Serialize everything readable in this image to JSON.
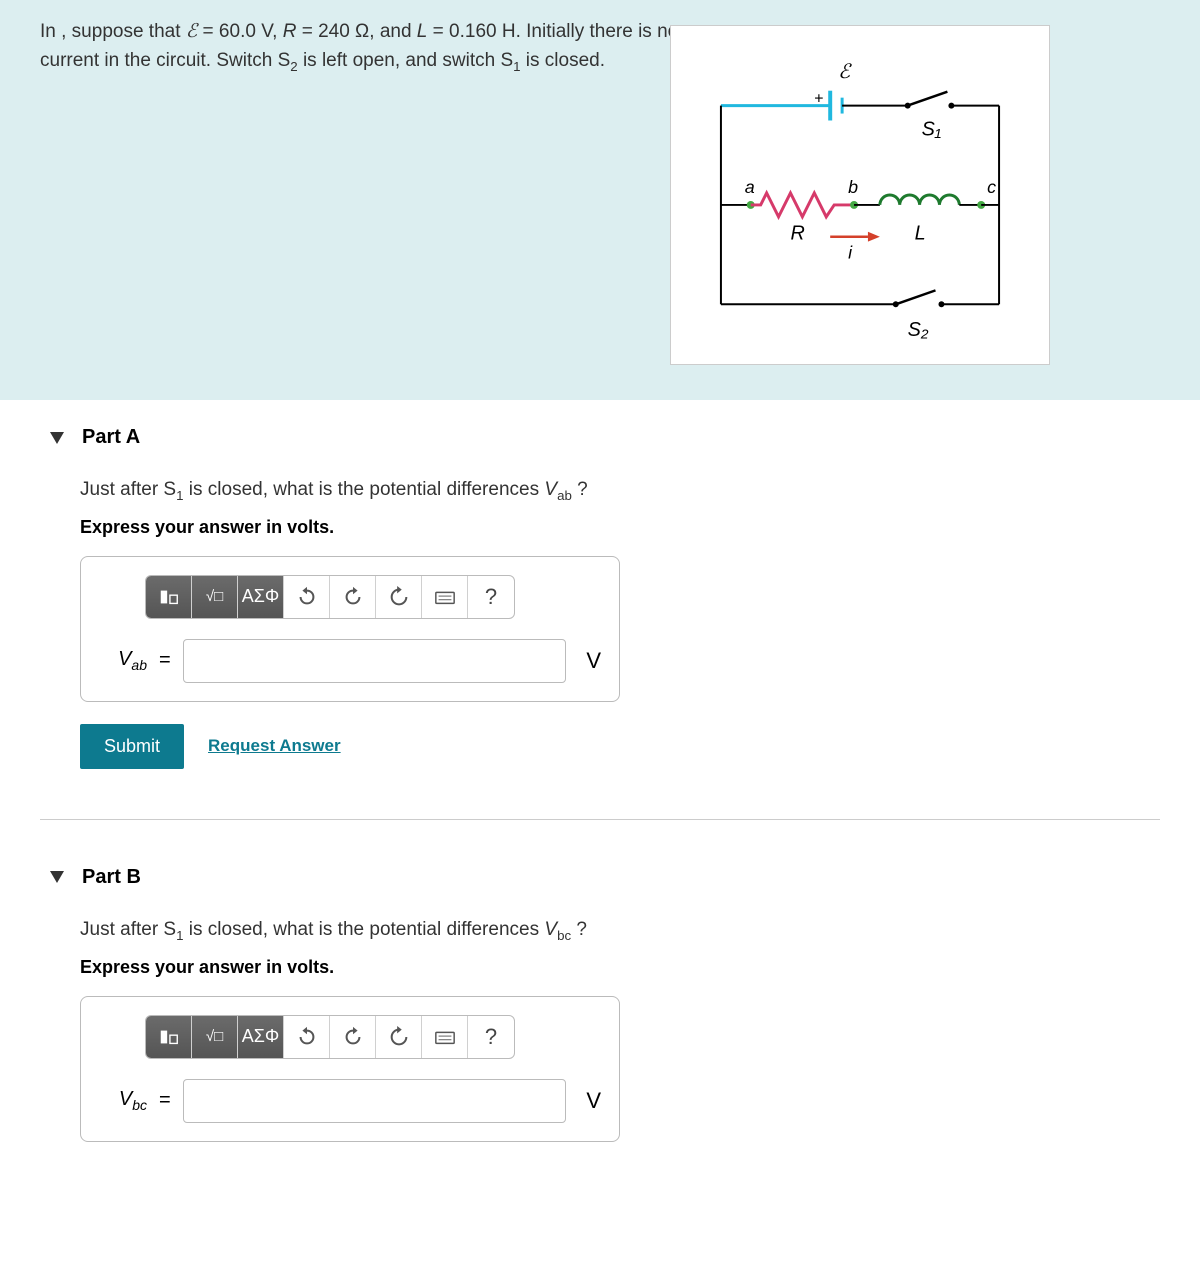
{
  "problem": {
    "text_html": "In , suppose that <i>ℰ</i> = 60.0 V, <i>R</i> = 240 Ω, and <i>L</i> = 0.160 H. Initially there is no current in the circuit. Switch S<sub>2</sub> is left open, and switch S<sub>1</sub> is closed."
  },
  "figure_labels": {
    "emf": "ℰ",
    "plus": "+",
    "s1": "S₁",
    "s2": "S₂",
    "a": "a",
    "b": "b",
    "c": "c",
    "r": "R",
    "l": "L",
    "i": "i"
  },
  "parts": [
    {
      "id": "A",
      "title": "Part A",
      "question_html": "Just after S<sub>1</sub> is closed, what is the potential differences <i>V</i><sub>ab</sub> ?",
      "hint": "Express your answer in volts.",
      "var_label_html": "<i>V</i><sub>ab</sub>",
      "unit": "V",
      "toolbar": {
        "greek": "ΑΣΦ",
        "help": "?"
      },
      "submit": "Submit",
      "request": "Request Answer"
    },
    {
      "id": "B",
      "title": "Part B",
      "question_html": "Just after S<sub>1</sub> is closed, what is the potential differences <i>V</i><sub>bc</sub> ?",
      "hint": "Express your answer in volts.",
      "var_label_html": "<i>V</i><sub>bc</sub>",
      "unit": "V",
      "toolbar": {
        "greek": "ΑΣΦ",
        "help": "?"
      },
      "submit": "Submit",
      "request": "Request Answer"
    }
  ]
}
